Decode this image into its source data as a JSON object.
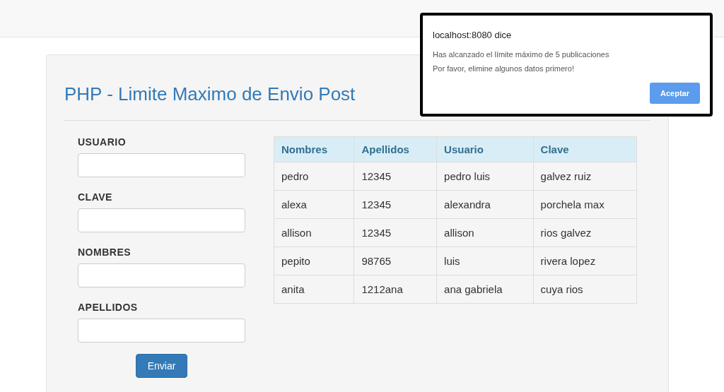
{
  "page": {
    "title": "PHP - Limite Maximo de Envio Post"
  },
  "form": {
    "fields": [
      {
        "label": "USUARIO"
      },
      {
        "label": "CLAVE"
      },
      {
        "label": "NOMBRES"
      },
      {
        "label": "APELLIDOS"
      }
    ],
    "submit": "Enviar"
  },
  "table": {
    "columns": [
      "Nombres",
      "Apellidos",
      "Usuario",
      "Clave"
    ],
    "rows": [
      [
        "pedro",
        "12345",
        "pedro luis",
        "galvez ruiz"
      ],
      [
        "alexa",
        "12345",
        "alexandra",
        "porchela max"
      ],
      [
        "allison",
        "12345",
        "allison",
        "rios galvez"
      ],
      [
        "pepito",
        "98765",
        "luis",
        "rivera lopez"
      ],
      [
        "anita",
        "1212ana",
        "ana gabriela",
        "cuya rios"
      ]
    ]
  },
  "dialog": {
    "title": "localhost:8080 dice",
    "message": [
      "Has alcanzado el límite máximo de 5 publicaciones",
      "Por favor, elimine algunos datos primero!"
    ],
    "button": "Aceptar"
  }
}
